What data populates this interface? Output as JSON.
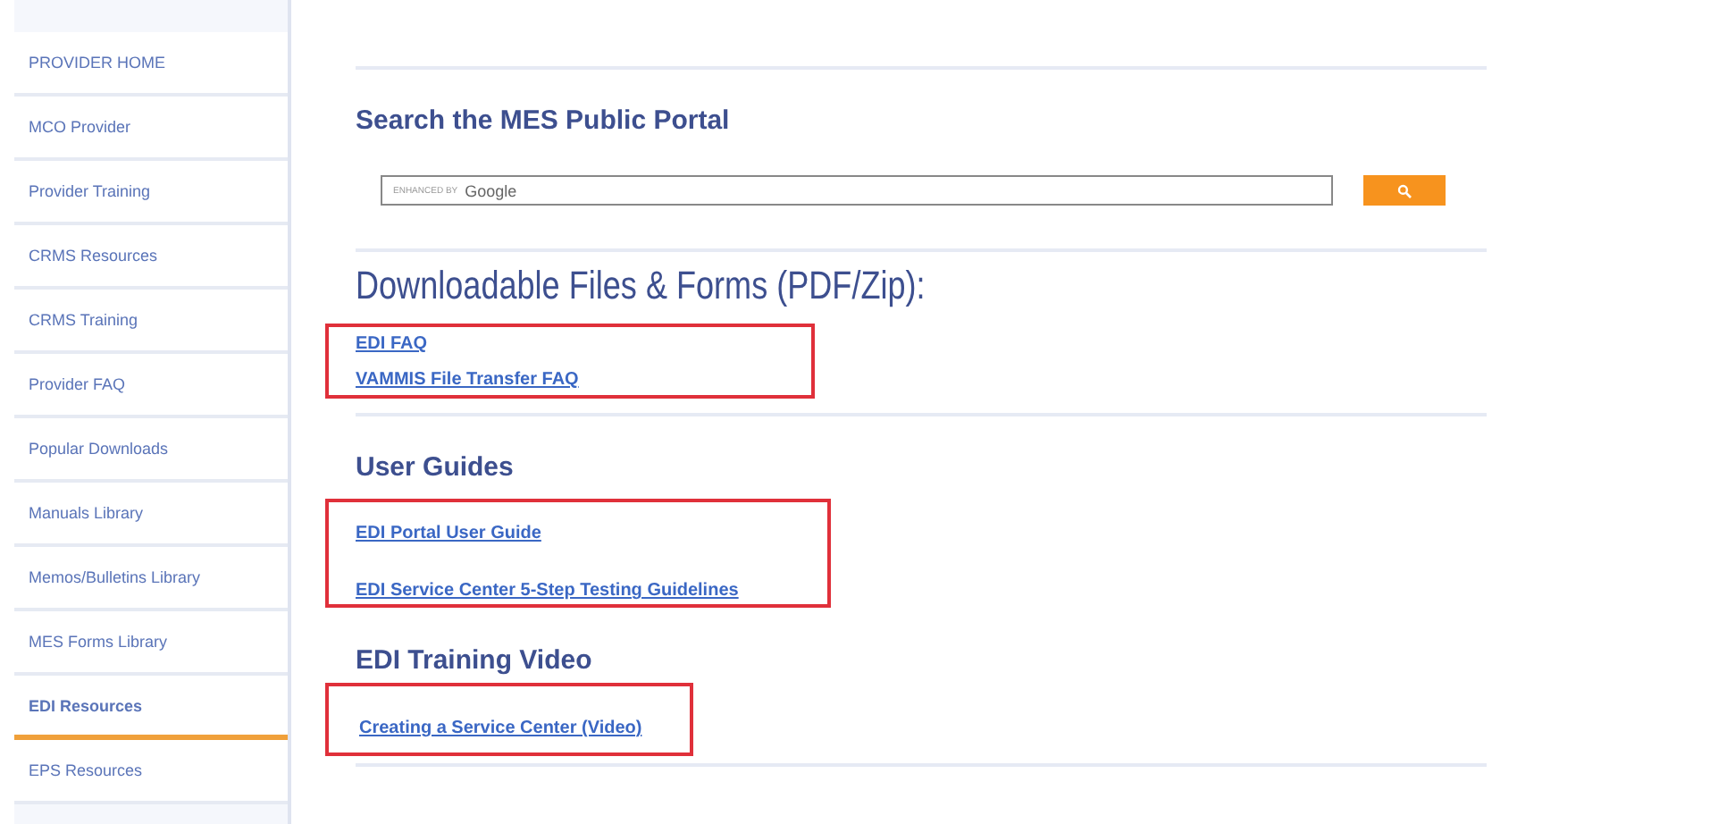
{
  "sidebar": {
    "items": [
      {
        "label": "PROVIDER HOME",
        "selected": false
      },
      {
        "label": "MCO Provider",
        "selected": false
      },
      {
        "label": "Provider Training",
        "selected": false
      },
      {
        "label": "CRMS Resources",
        "selected": false
      },
      {
        "label": "CRMS Training",
        "selected": false
      },
      {
        "label": "Provider FAQ",
        "selected": false
      },
      {
        "label": "Popular Downloads",
        "selected": false
      },
      {
        "label": "Manuals Library",
        "selected": false
      },
      {
        "label": "Memos/Bulletins Library",
        "selected": false
      },
      {
        "label": "MES Forms Library",
        "selected": false
      },
      {
        "label": "EDI Resources",
        "selected": true
      },
      {
        "label": "EPS Resources",
        "selected": false
      }
    ]
  },
  "search": {
    "heading": "Search the MES Public Portal",
    "enhanced_label": "ENHANCED BY",
    "brand": "Google"
  },
  "downloads": {
    "heading": "Downloadable Files & Forms (PDF/Zip):",
    "highlighted": true,
    "links": [
      "EDI FAQ",
      "VAMMIS File Transfer FAQ"
    ]
  },
  "user_guides": {
    "heading": "User Guides",
    "highlighted": true,
    "links": [
      "EDI Portal User Guide",
      "EDI Service Center 5-Step Testing Guidelines"
    ]
  },
  "training_video": {
    "heading": "EDI Training Video",
    "highlighted": true,
    "links": [
      "Creating a Service Center (Video)"
    ]
  }
}
